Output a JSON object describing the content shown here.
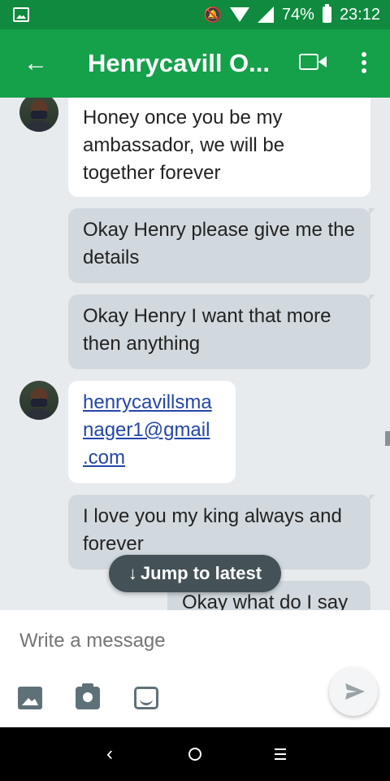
{
  "status_bar": {
    "battery": "74%",
    "time": "23:12"
  },
  "app_bar": {
    "title": "Henrycavill O..."
  },
  "messages": [
    {
      "direction": "in",
      "text": "Honey once you be my ambassador, we will be together forever"
    },
    {
      "direction": "out",
      "text": "Okay Henry please give me the details"
    },
    {
      "direction": "out",
      "text": "Okay Henry I want that more then anything"
    },
    {
      "direction": "in",
      "link": "henrycavillsmanager1@gmail.com",
      "lines": [
        "henrycavillsma",
        "nager1@gmail",
        ".com"
      ]
    },
    {
      "direction": "out",
      "text": "I love you my king always and forever"
    },
    {
      "direction": "out",
      "text": "Okay what do I say"
    }
  ],
  "jump_button": {
    "label": "Jump to latest",
    "icon": "arrow-down-icon"
  },
  "composer": {
    "placeholder": "Write a message"
  },
  "colors": {
    "status_bar": "#0f8a3e",
    "app_bar": "#15a04a",
    "incoming_bubble": "#ffffff",
    "outgoing_bubble": "#d1d9de",
    "link": "#2346a8",
    "background": "#e8ebee"
  }
}
